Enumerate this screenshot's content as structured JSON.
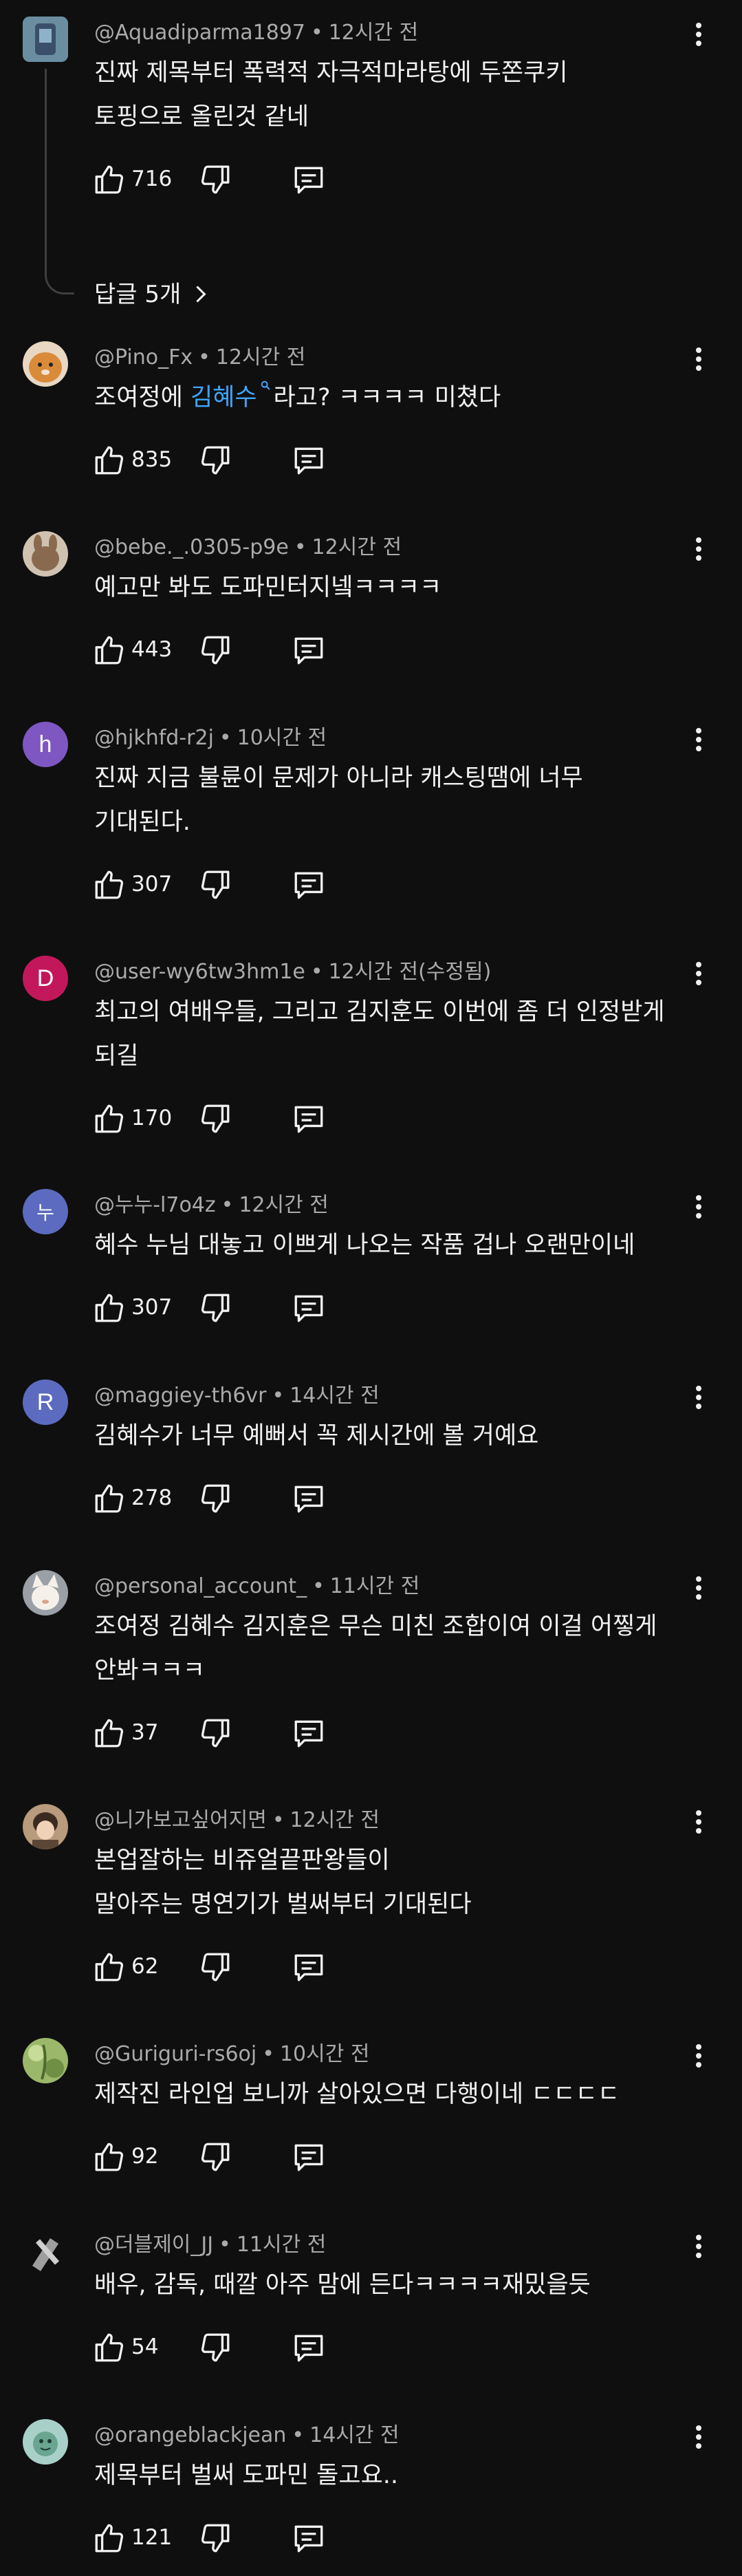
{
  "colors": {
    "background": "#0f0f0f",
    "text": "#f1f1f1",
    "meta": "#aaaaaa",
    "link": "#3ea6ff"
  },
  "icons": {
    "like": "thumbs-up-icon",
    "dislike": "thumbs-down-icon",
    "reply": "reply-icon",
    "menu": "more-vert-icon",
    "search": "search-icon"
  },
  "comments": [
    {
      "author": "@Aquadiparma1897",
      "time": "12시간 전",
      "text": "진짜 제목부터 폭력적 자극적마라탕에 두쫀쿠키\n토핑으로 올린것 같네",
      "likes": "716",
      "replies_label": "답글 5개",
      "avatar_letter": ""
    },
    {
      "author": "@Pino_Fx",
      "time": "12시간 전",
      "text_before": "조여정에 ",
      "mention": "김혜수",
      "text_after": "라고? ㅋㅋㅋㅋ 미쳤다",
      "likes": "835",
      "avatar_letter": ""
    },
    {
      "author": "@bebe._.0305-p9e",
      "time": "12시간 전",
      "text": "예고만 봐도 도파민터지넼ㅋㅋㅋㅋ",
      "likes": "443",
      "avatar_letter": ""
    },
    {
      "author": "@hjkhfd-r2j",
      "time": "10시간 전",
      "text": "진짜 지금 불륜이 문제가 아니라 캐스팅땜에 너무\n기대된다.",
      "likes": "307",
      "avatar_letter": "h"
    },
    {
      "author": "@user-wy6tw3hm1e",
      "time": "12시간 전(수정됨)",
      "text": "최고의 여배우들, 그리고 김지훈도 이번에 좀 더 인정받게\n되길",
      "likes": "170",
      "avatar_letter": "D"
    },
    {
      "author": "@누누-l7o4z",
      "time": "12시간 전",
      "text": "혜수 누님 대놓고 이쁘게 나오는 작품 겁나 오랜만이네",
      "likes": "307",
      "avatar_letter": "누"
    },
    {
      "author": "@maggiey-th6vr",
      "time": "14시간 전",
      "text": "김혜수가 너무 예뻐서 꼭 제시간에 볼 거예요",
      "likes": "278",
      "avatar_letter": "R"
    },
    {
      "author": "@personal_account_",
      "time": "11시간 전",
      "text": "조여정 김혜수 김지훈은 무슨 미친 조합이여 이걸 어찧게\n안봐ㅋㅋㅋ",
      "likes": "37",
      "avatar_letter": ""
    },
    {
      "author": "@니가보고싶어지면",
      "time": "12시간 전",
      "text": "본업잘하는 비쥬얼끝판왕들이\n말아주는 명연기가 벌써부터 기대된다",
      "likes": "62",
      "avatar_letter": ""
    },
    {
      "author": "@Guriguri-rs6oj",
      "time": "10시간 전",
      "text": "제작진 라인업 보니까 살아있으면 다행이네 ㄷㄷㄷㄷ",
      "likes": "92",
      "avatar_letter": ""
    },
    {
      "author": "@더블제이_JJ",
      "time": "11시간 전",
      "text": "배우, 감독, 때깔 아주 맘에 든다ㅋㅋㅋㅋ재밌을듯",
      "likes": "54",
      "avatar_letter": ""
    },
    {
      "author": "@orangeblackjean",
      "time": "14시간 전",
      "text": "제목부터 벌써 도파민 돌고요..",
      "likes": "121",
      "avatar_letter": ""
    }
  ]
}
